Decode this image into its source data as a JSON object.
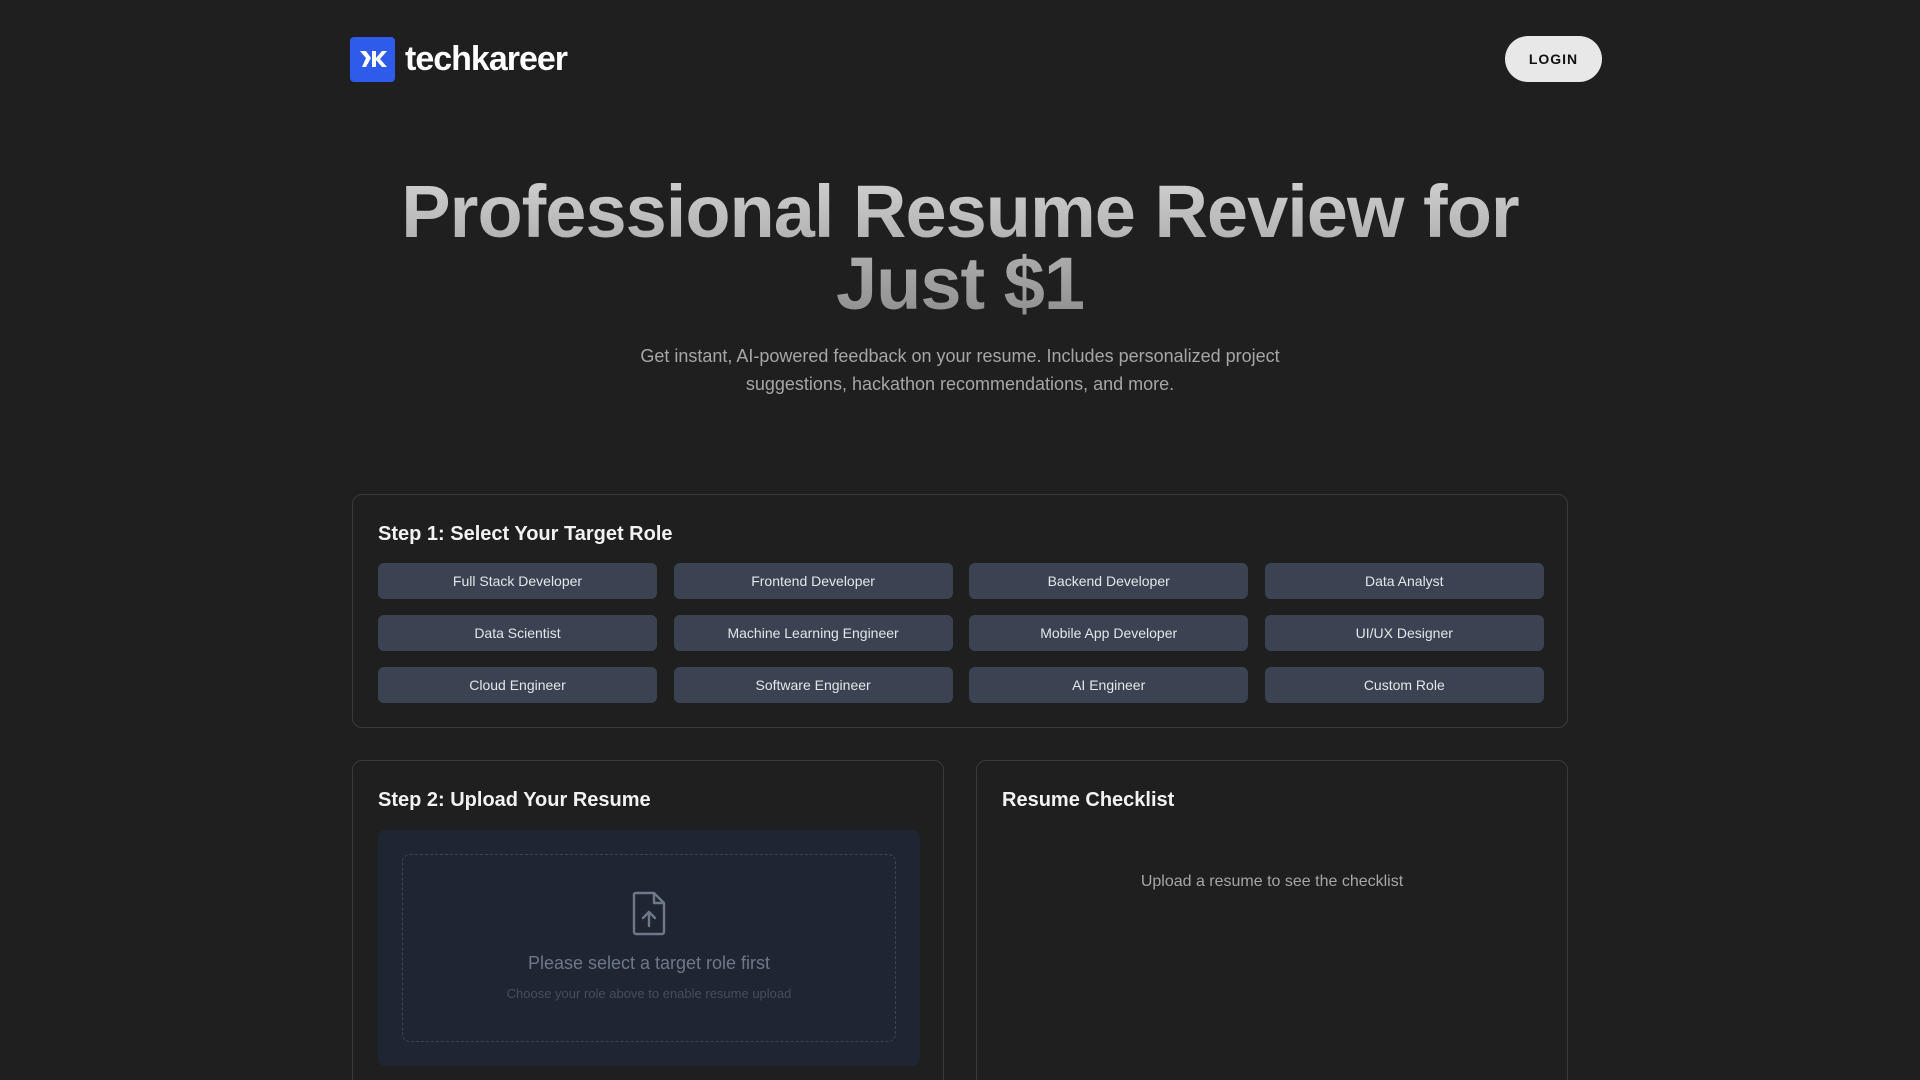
{
  "header": {
    "brand": "techkareer",
    "login_label": "LOGIN"
  },
  "hero": {
    "title": "Professional Resume Review for Just $1",
    "subtitle": "Get instant, AI-powered feedback on your resume. Includes personalized project suggestions, hackathon recommendations, and more."
  },
  "step1": {
    "title": "Step 1: Select Your Target Role",
    "roles": [
      "Full Stack Developer",
      "Frontend Developer",
      "Backend Developer",
      "Data Analyst",
      "Data Scientist",
      "Machine Learning Engineer",
      "Mobile App Developer",
      "UI/UX Designer",
      "Cloud Engineer",
      "Software Engineer",
      "AI Engineer",
      "Custom Role"
    ]
  },
  "step2": {
    "title": "Step 2: Upload Your Resume",
    "upload_title": "Please select a target role first",
    "upload_sub": "Choose your role above to enable resume upload",
    "icon": "file-upload-icon"
  },
  "checklist": {
    "title": "Resume Checklist",
    "empty_text": "Upload a resume to see the checklist"
  },
  "colors": {
    "background": "#1f1f1f",
    "brand": "#2f5bea",
    "role_button": "#3b4252",
    "upload_bg": "#1e2634"
  }
}
